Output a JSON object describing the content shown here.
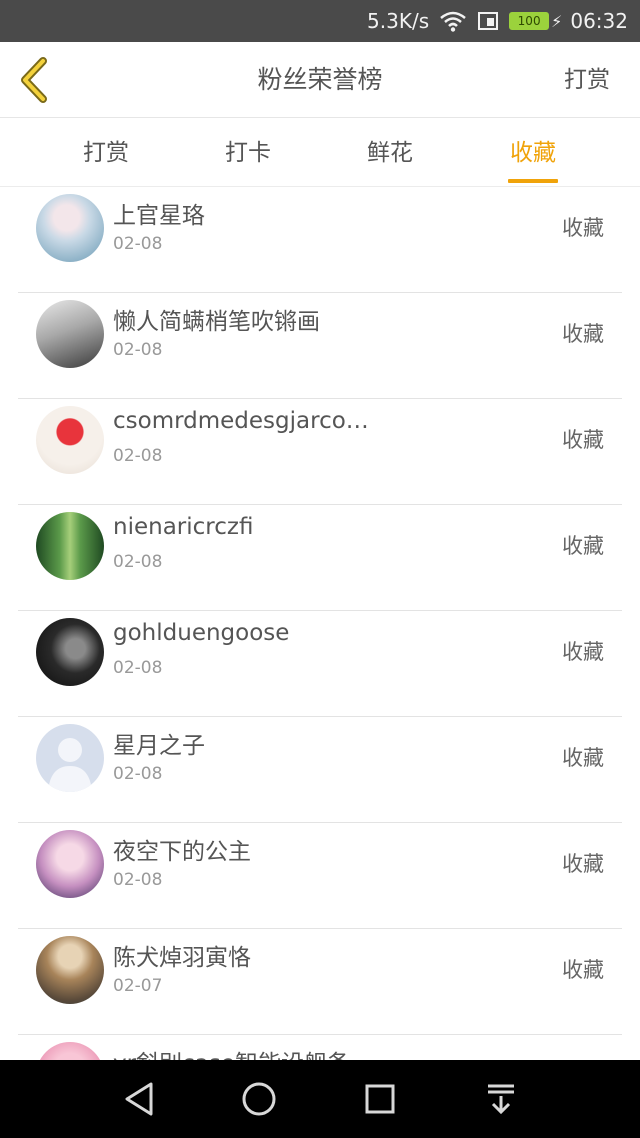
{
  "status_bar": {
    "network_speed": "5.3K/s",
    "battery_level": "100",
    "time": "06:32",
    "icons": [
      "wifi-icon",
      "sim-icon",
      "battery-icon",
      "charging-icon"
    ]
  },
  "nav": {
    "title": "粉丝荣誉榜",
    "right_action": "打赏",
    "back_icon": "chevron-left-icon",
    "accent_color": "#f0a30a"
  },
  "tabs": [
    {
      "label": "打赏",
      "active": false
    },
    {
      "label": "打卡",
      "active": false
    },
    {
      "label": "鲜花",
      "active": false
    },
    {
      "label": "收藏",
      "active": true
    }
  ],
  "list": [
    {
      "name": "上官星珞",
      "date": "02-08",
      "action": "收藏"
    },
    {
      "name": "懒人简螨梢笔吹锵画",
      "date": "02-08",
      "action": "收藏"
    },
    {
      "name": "csomrdmedesgjarco…",
      "date": "02-08",
      "action": "收藏"
    },
    {
      "name": "nienaricrczfi",
      "date": "02-08",
      "action": "收藏"
    },
    {
      "name": "gohlduengoose",
      "date": "02-08",
      "action": "收藏"
    },
    {
      "name": "星月之子",
      "date": "02-08",
      "action": "收藏"
    },
    {
      "name": "夜空下的公主",
      "date": "02-08",
      "action": "收藏"
    },
    {
      "name": "陈犬焯羽寅恪",
      "date": "02-07",
      "action": "收藏"
    },
    {
      "name": "yr斜别case智能设舰备",
      "date": "",
      "action": ""
    }
  ],
  "system_nav": [
    "back-triangle-icon",
    "home-circle-icon",
    "recents-square-icon",
    "notification-pull-icon"
  ]
}
